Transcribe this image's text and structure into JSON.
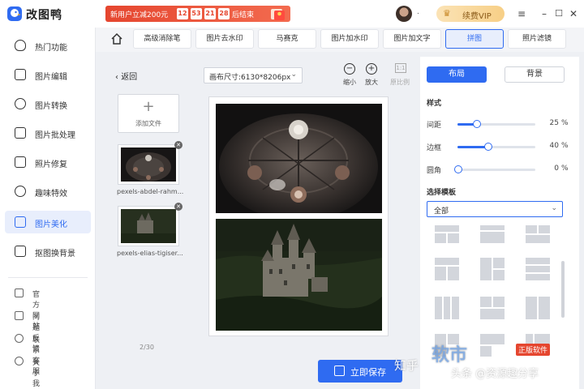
{
  "app": {
    "name": "改图鸭"
  },
  "promo": {
    "text": "新用户立减200元",
    "timer": [
      "12",
      "53",
      "21",
      "28"
    ],
    "suffix": "后结束"
  },
  "user": {
    "name": "."
  },
  "vip": {
    "label": "续费VIP"
  },
  "sidebar": {
    "items": [
      {
        "label": "热门功能",
        "icon": "fire-icon"
      },
      {
        "label": "图片编辑",
        "icon": "image-edit-icon"
      },
      {
        "label": "图片转换",
        "icon": "image-convert-icon"
      },
      {
        "label": "图片批处理",
        "icon": "batch-icon"
      },
      {
        "label": "照片修复",
        "icon": "repair-icon"
      },
      {
        "label": "趣味特效",
        "icon": "sparkle-icon"
      },
      {
        "label": "图片美化",
        "icon": "beautify-icon",
        "active": true
      },
      {
        "label": "抠图换背景",
        "icon": "cutout-icon"
      }
    ],
    "footer": [
      {
        "label": "官方网站",
        "icon": "website-icon"
      },
      {
        "label": "问题反馈",
        "icon": "feedback-icon"
      },
      {
        "label": "联系客服",
        "icon": "support-icon"
      },
      {
        "label": "关于我们",
        "icon": "info-icon"
      }
    ]
  },
  "tabs": [
    {
      "label": "高级消除笔"
    },
    {
      "label": "图片去水印"
    },
    {
      "label": "马赛克"
    },
    {
      "label": "图片加水印"
    },
    {
      "label": "图片加文字"
    },
    {
      "label": "拼图",
      "active": true
    },
    {
      "label": "照片滤镜"
    }
  ],
  "editor": {
    "back_label": "返回",
    "add_file_label": "添加文件",
    "files": [
      {
        "name": "pexels-abdel-rahm..."
      },
      {
        "name": "pexels-elias-tigiser..."
      }
    ],
    "page_count": "2/30",
    "canvas_size": "画布尺寸:6130*8206px",
    "zoom_out_label": "缩小",
    "zoom_in_label": "放大",
    "ratio_label": "原比例",
    "ratio_box": "1:1",
    "save_label": "立即保存"
  },
  "panel": {
    "layout_tab": "布局",
    "background_tab": "背景",
    "style_title": "样式",
    "sliders": [
      {
        "label": "间距",
        "value": 25,
        "unit": "%"
      },
      {
        "label": "边框",
        "value": 40,
        "unit": "%"
      },
      {
        "label": "圆角",
        "value": 0,
        "unit": "%"
      }
    ],
    "template_title": "选择模板",
    "template_value": "全部"
  },
  "watermarks": {
    "zhihu": "知乎",
    "site": "软市",
    "badge": "正版软件",
    "toutiao": "头条 @资源趣分享"
  },
  "colors": {
    "accent": "#2f6bf1",
    "promo": "#e5462f",
    "vip": "#f7cf86"
  }
}
